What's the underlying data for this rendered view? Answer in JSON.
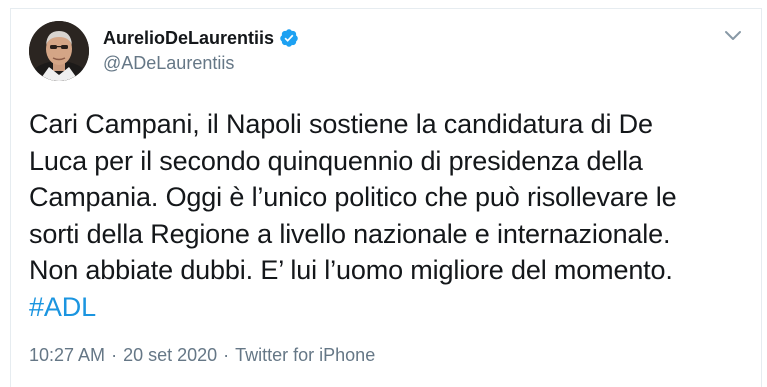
{
  "author": {
    "display_name": "AurelioDeLaurentiis",
    "handle": "@ADeLaurentiis",
    "verified": true,
    "verified_color": "#1da1f2",
    "avatar_icon": "profile-photo"
  },
  "tweet": {
    "lines": [
      "Cari Campani, il Napoli sostiene la candidatura di De",
      "Luca per il secondo quinquennio di presidenza della",
      "Campania. Oggi è l’unico politico che può risollevare le",
      "sorti della Regione a livello nazionale e internazionale.",
      "Non abbiate dubbi. E’ lui l’uomo migliore del momento."
    ],
    "hashtag": "#ADL",
    "hashtag_color": "#1b95e0"
  },
  "meta": {
    "time": "10:27 AM",
    "separator": "·",
    "date": "20 set 2020",
    "source": "Twitter for iPhone"
  },
  "menu": {
    "icon": "chevron-down-icon"
  }
}
